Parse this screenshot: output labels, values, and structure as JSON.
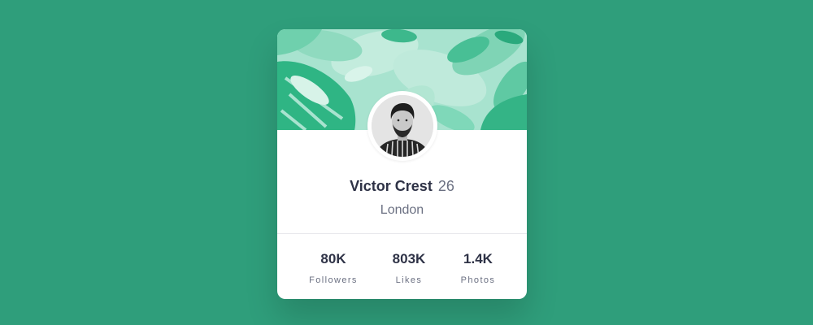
{
  "profile": {
    "name": "Victor Crest",
    "age": "26",
    "city": "London"
  },
  "stats": [
    {
      "value": "80K",
      "label": "Followers"
    },
    {
      "value": "803K",
      "label": "Likes"
    },
    {
      "value": "1.4K",
      "label": "Photos"
    }
  ],
  "colors": {
    "page_background": "#2f9e7b",
    "card_background": "#ffffff",
    "banner_mint": "#9ee0ca",
    "leaf_green": "#5fd1aa",
    "text_dark": "#2e3246",
    "text_muted": "#6b7082"
  },
  "icons": {
    "banner": "tropical-leaves-pattern",
    "avatar": "profile-photo"
  }
}
